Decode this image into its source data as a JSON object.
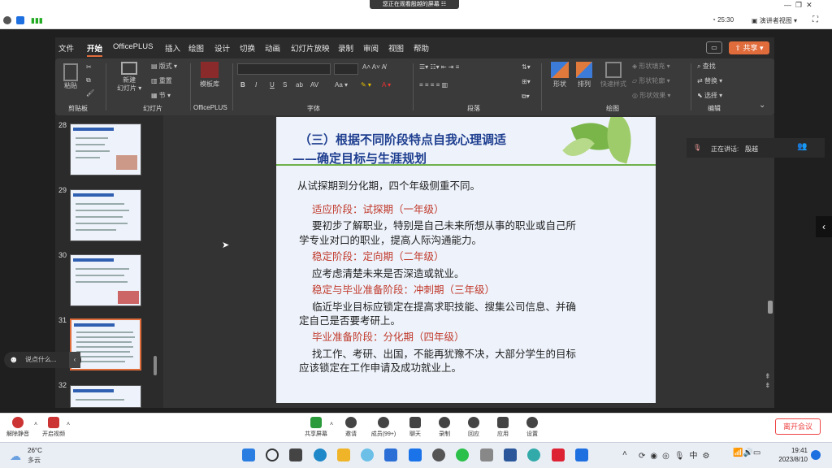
{
  "meeting": {
    "share_banner": "您正在观看殷越的屏幕",
    "timer": "25:30",
    "view_mode": "演讲者视图",
    "speaker_label": "正在讲话:",
    "speaker_name": "殷越",
    "leave_label": "离开会议",
    "toolbar": [
      {
        "label": "解除静音"
      },
      {
        "label": "开启视频"
      },
      {
        "label": "共享屏幕"
      },
      {
        "label": "邀请"
      },
      {
        "label": "成员(99+)"
      },
      {
        "label": "聊天"
      },
      {
        "label": "录制"
      },
      {
        "label": "回应"
      },
      {
        "label": "应用"
      },
      {
        "label": "设置"
      }
    ],
    "chat_placeholder": "说点什么..."
  },
  "ppt": {
    "menu": [
      "文件",
      "开始",
      "OfficePLUS",
      "插入",
      "绘图",
      "设计",
      "切换",
      "动画",
      "幻灯片放映",
      "录制",
      "审阅",
      "视图",
      "帮助"
    ],
    "share_button": "共享",
    "ribbon": {
      "paste": "粘贴",
      "clipboard": "剪贴板",
      "new_slide_1": "新建",
      "new_slide_2": "幻灯片",
      "layout": "版式",
      "reset": "重置",
      "section": "节",
      "slides_group": "幻灯片",
      "template": "模板库",
      "officeplus_group": "OfficePLUS",
      "font_group": "字体",
      "paragraph_group": "段落",
      "shape": "形状",
      "arrange": "排列",
      "quick_style": "快速样式",
      "shape_fill": "形状填充",
      "shape_outline": "形状轮廓",
      "shape_effect": "形状效果",
      "drawing_group": "绘图",
      "find": "查找",
      "replace": "替换",
      "select": "选择",
      "editing_group": "编辑"
    },
    "thumbnails": [
      "28",
      "29",
      "30",
      "31",
      "32"
    ],
    "selected_slide": "31"
  },
  "slide": {
    "title_line1": "（三）根据不同阶段特点自我心理调适",
    "title_line2": "——确定目标与生涯规划",
    "lines": [
      {
        "text": "从试探期到分化期，四个年级侧重不同。",
        "red": false
      },
      {
        "text": "适应阶段：试探期（一年级）",
        "red": true
      },
      {
        "text": "要初步了解职业，特别是自己未来所想从事的职业或自己所",
        "red": false
      },
      {
        "text": "学专业对口的职业，提高人际沟通能力。",
        "red": false
      },
      {
        "text": "稳定阶段：定向期（二年级）",
        "red": true
      },
      {
        "text": "应考虑清楚未来是否深造或就业。",
        "red": false
      },
      {
        "text": "稳定与毕业准备阶段：冲刺期（三年级）",
        "red": true
      },
      {
        "text": "临近毕业目标应锁定在提高求职技能、搜集公司信息、并确",
        "red": false
      },
      {
        "text": "定自己是否要考研上。",
        "red": false
      },
      {
        "text": "毕业准备阶段：分化期（四年级）",
        "red": true
      },
      {
        "text": "找工作、考研、出国，不能再犹豫不决，大部分学生的目标",
        "red": false
      },
      {
        "text": "应该锁定在工作申请及成功就业上。",
        "red": false
      }
    ]
  },
  "taskbar": {
    "weather_temp": "26°C",
    "weather_desc": "多云",
    "time": "19:41",
    "date": "2023/8/10"
  }
}
